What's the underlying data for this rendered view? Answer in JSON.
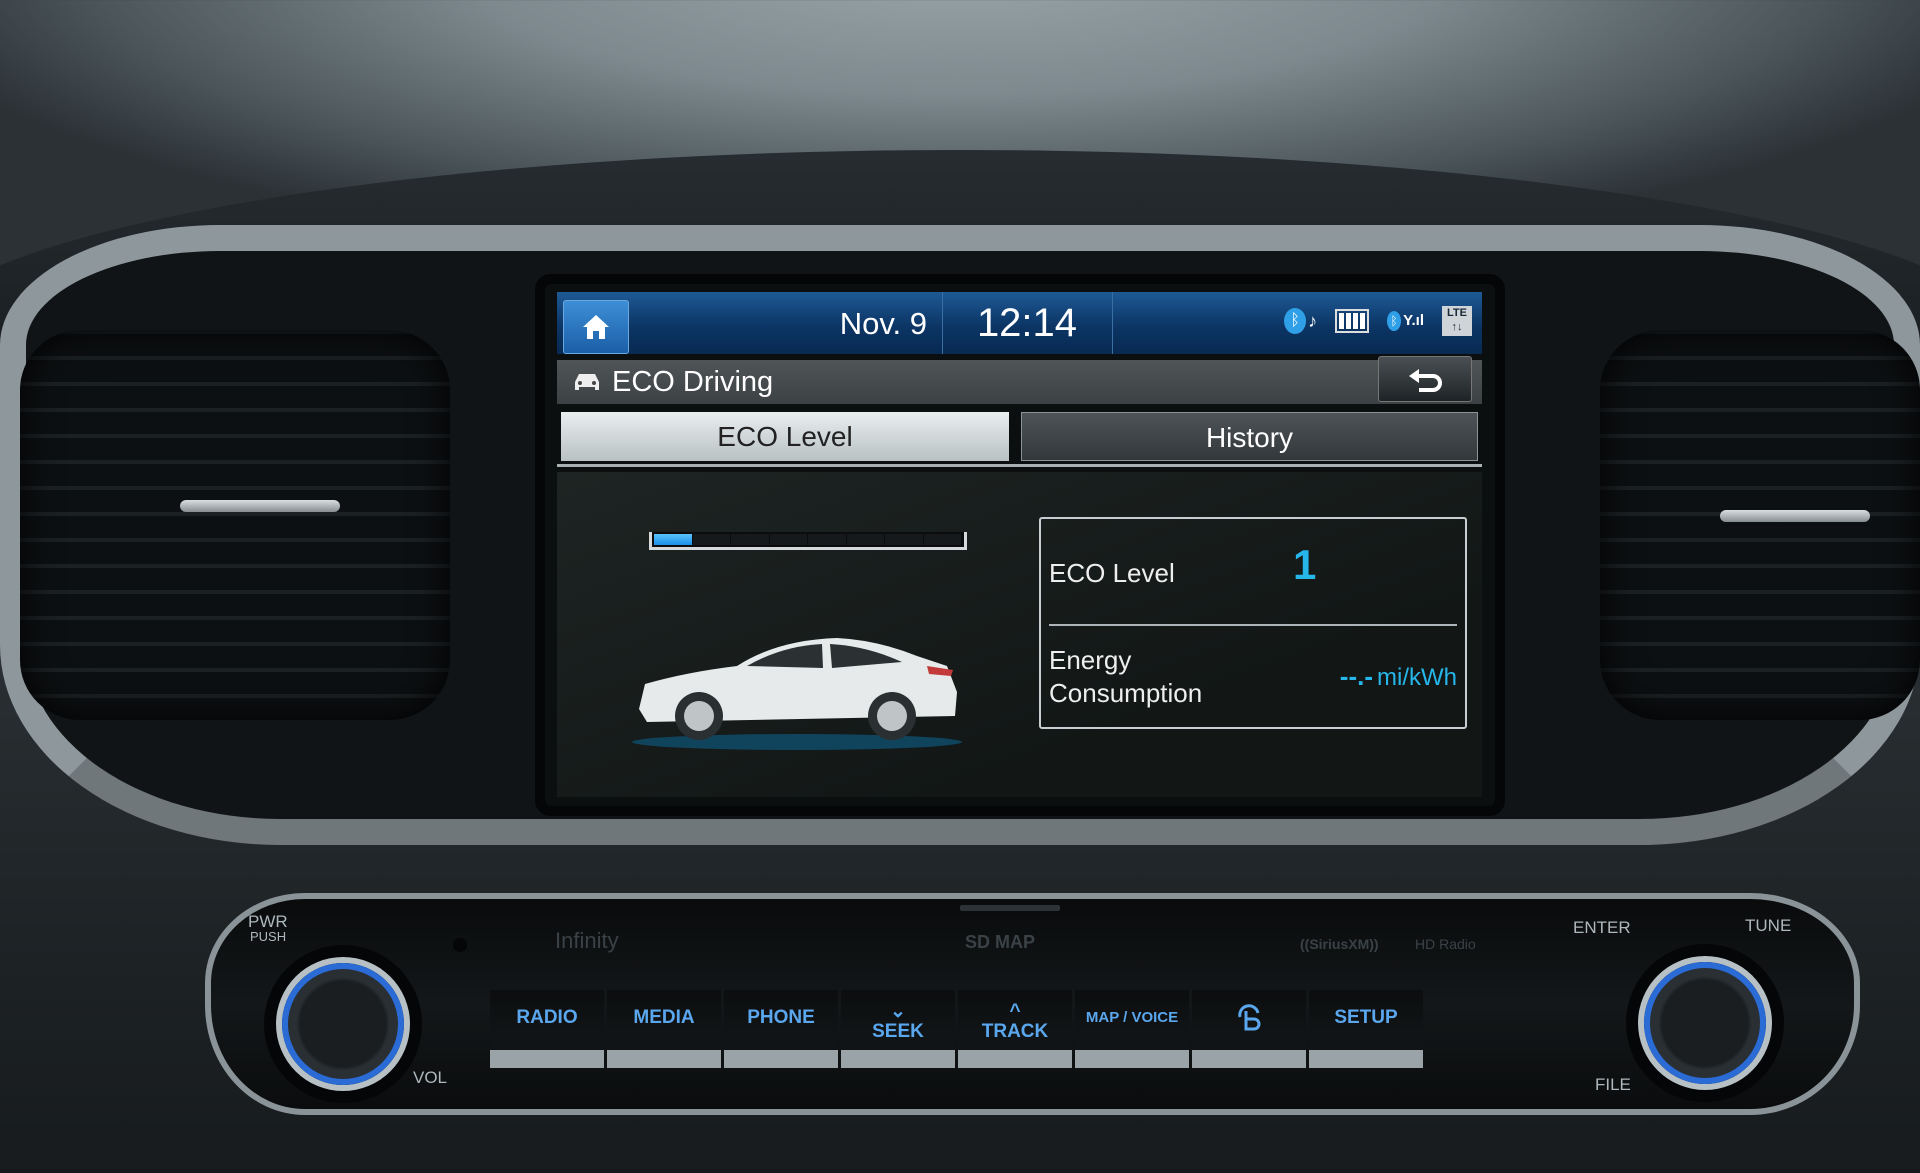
{
  "status_bar": {
    "home_icon": "home-icon",
    "date": "Nov.  9",
    "time": "12:14",
    "icons": [
      "bluetooth-audio-icon",
      "battery-icon",
      "bluetooth-signal-icon",
      "lte-data-icon"
    ],
    "lte_label": "LTE",
    "lte_arrows": "↑↓",
    "bt_glyph": "ᛒ",
    "music_glyph": "♪",
    "signal_glyph": "Y.ıl"
  },
  "title_bar": {
    "icon": "car-eco-icon",
    "title": "ECO Driving",
    "back_icon": "back-arrow-icon"
  },
  "tabs": [
    {
      "label": "ECO Level",
      "active": true
    },
    {
      "label": "History",
      "active": false
    }
  ],
  "eco_panel": {
    "eco_level_gauge": {
      "filled_segments": 1,
      "total_segments": 8
    },
    "eco_level_label": "ECO Level",
    "eco_level_value": "1",
    "energy_label_line1": "Energy",
    "energy_label_line2": "Consumption",
    "energy_value": "--.-",
    "energy_unit": "mi/kWh",
    "accent_color": "#27b6ea"
  },
  "control_panel": {
    "left_knob_top_label_1": "PWR",
    "left_knob_top_label_2": "PUSH",
    "left_knob_bottom_label": "VOL",
    "right_knob_top_left_label": "ENTER",
    "right_knob_top_right_label": "TUNE",
    "right_knob_bottom_label": "FILE",
    "brand_infinity": "Infinity",
    "brand_sd_map": "SD MAP",
    "brand_siriusxm": "((SiriusXM))",
    "brand_hd_radio": "HD Radio",
    "buttons": [
      {
        "label": "RADIO"
      },
      {
        "label": "MEDIA"
      },
      {
        "label": "PHONE"
      },
      {
        "label": "SEEK",
        "prefix": "⌄"
      },
      {
        "label": "TRACK",
        "prefix": "^"
      },
      {
        "label": "MAP / VOICE"
      },
      {
        "label": "",
        "icon": "bluelink-icon"
      },
      {
        "label": "SETUP"
      }
    ],
    "button_color": "#5aa7ee"
  }
}
